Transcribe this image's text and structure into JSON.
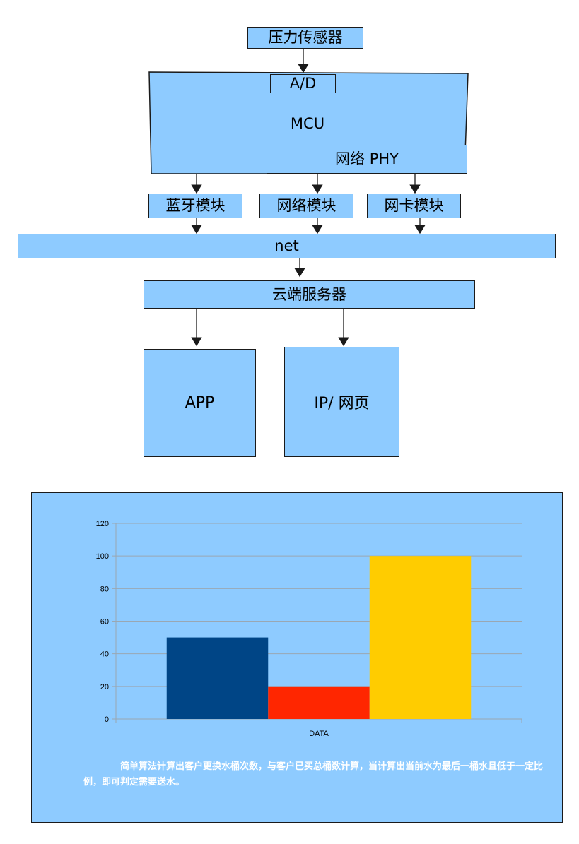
{
  "diagram": {
    "sensor": "压力传感器",
    "adc": "A/D",
    "mcu": "MCU",
    "phy": "网络 PHY",
    "bluetooth": "蓝牙模块",
    "network_module": "网络模块",
    "nic_module": "网卡模块",
    "net": "net",
    "cloud": "云端服务器",
    "app": "APP",
    "web": "IP/ 网页"
  },
  "colors": {
    "box_fill": "#8ecbff",
    "border": "#1a1a1a",
    "bar_1": "#004586",
    "bar_2": "#ff2600",
    "bar_3": "#ffcc00",
    "note_text": "#ffffff"
  },
  "chart_data": {
    "type": "bar",
    "categories": [
      "DATA"
    ],
    "series": [
      {
        "values": [
          50
        ]
      },
      {
        "values": [
          20
        ]
      },
      {
        "values": [
          100
        ]
      }
    ],
    "ylim": [
      0,
      120
    ],
    "yticks": [
      0,
      20,
      40,
      60,
      80,
      100,
      120
    ],
    "grid": true,
    "note": "简单算法计算出客户更换水桶次数，与客户已买总桶数计算，当计算出当前水为最后一桶水且低于一定比例，即可判定需要送水。"
  }
}
